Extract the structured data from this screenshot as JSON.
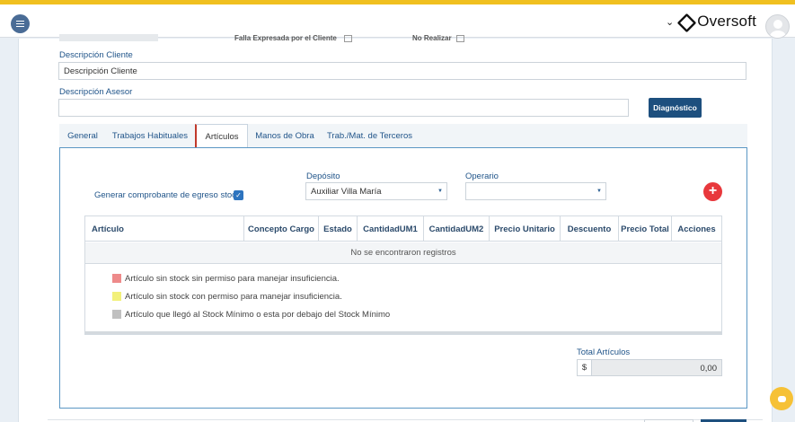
{
  "header": {
    "brand_name": "Oversoft",
    "icons": [
      "menu-icon",
      "chevron-down-icon",
      "oversoft-logo-icon",
      "user-avatar-icon"
    ]
  },
  "form": {
    "top_partial_labels": [
      "Falla Expresada por el Cliente",
      "No Realizar"
    ],
    "descripcion_cliente_label": "Descripción Cliente",
    "descripcion_cliente_value": "Descripción Cliente",
    "descripcion_asesor_label": "Descripción Asesor",
    "descripcion_asesor_value": "",
    "diagnostico_button": "Diagnóstico"
  },
  "tabs": [
    {
      "label": "General",
      "active": false
    },
    {
      "label": "Trabajos Habituales",
      "active": false
    },
    {
      "label": "Artículos",
      "active": true
    },
    {
      "label": "Manos de Obra",
      "active": false
    },
    {
      "label": "Trab./Mat. de Terceros",
      "active": false
    }
  ],
  "articulos": {
    "generar_label": "Generar comprobante de egreso stock",
    "generar_checked": true,
    "deposito_label": "Depósito",
    "deposito_value": "Auxiliar Villa María",
    "operario_label": "Operario",
    "operario_value": "",
    "add_icon": "plus-icon",
    "columns": [
      "Artículo",
      "Concepto Cargo",
      "Estado",
      "CantidadUM1",
      "CantidadUM2",
      "Precio Unitario",
      "Descuento",
      "Precio Total",
      "Acciones"
    ],
    "empty_message": "No se encontraron registros",
    "legend": [
      {
        "label": "Artículo sin stock sin permiso para manejar insuficiencia.",
        "color": "#ee8a8a"
      },
      {
        "label": "Artículo sin stock con permiso para manejar insuficiencia.",
        "color": "#f2f07a"
      },
      {
        "label": "Artículo que llegó al Stock Mínimo o esta por debajo del Stock Mínimo",
        "color": "#c0c0c0"
      }
    ],
    "total_label": "Total Artículos",
    "total_currency": "$",
    "total_value": "0,00"
  },
  "colors": {
    "accent": "#1d4f7e",
    "top_strip": "#f0c020",
    "add_button": "#e8383c",
    "chat": "#f6c136"
  }
}
